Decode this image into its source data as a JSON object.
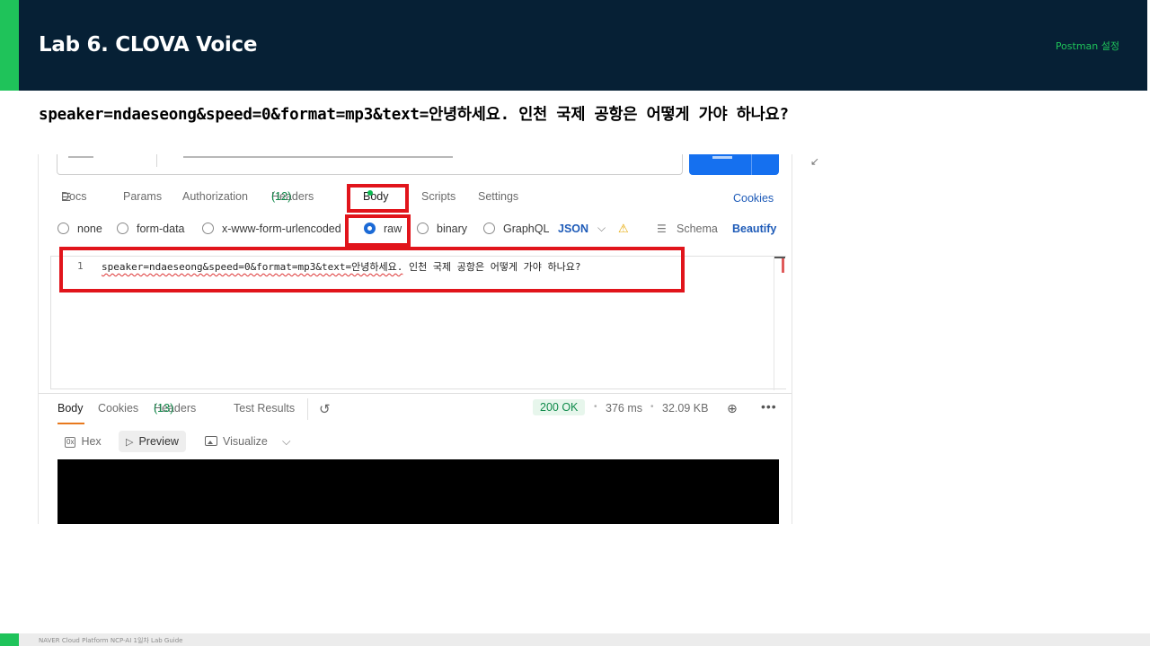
{
  "header": {
    "title": "Lab 6. CLOVA Voice",
    "right_label": "Postman 설정"
  },
  "body_param_line": "speaker=ndaeseong&speed=0&format=mp3&text=안녕하세요. 인천 국제 공항은 어떻게 가야 하나요?",
  "request_tabs": {
    "docs": "Docs",
    "params": "Params",
    "authorization": "Authorization",
    "headers_label": "Headers",
    "headers_count": "(12)",
    "body": "Body",
    "scripts": "Scripts",
    "settings": "Settings",
    "cookies": "Cookies"
  },
  "body_types": {
    "none": "none",
    "form_data": "form-data",
    "urlencoded": "x-www-form-urlencoded",
    "raw": "raw",
    "binary": "binary",
    "graphql": "GraphQL",
    "selected": "raw",
    "format": "JSON",
    "schema": "Schema",
    "beautify": "Beautify"
  },
  "editor": {
    "line_number": "1",
    "code_underlined": "speaker=ndaeseong&speed=0&format=mp3&text=안녕하세요.",
    "code_rest": " 인천 국제 공항은 어떻게 가야 하나요?"
  },
  "response_tabs": {
    "body": "Body",
    "cookies": "Cookies",
    "headers_label": "Headers",
    "headers_count": "(13)",
    "test_results": "Test Results"
  },
  "response_status": {
    "status": "200 OK",
    "time": "376 ms",
    "size": "32.09 KB"
  },
  "view_modes": {
    "hex_icon": "0x",
    "hex": "Hex",
    "preview": "Preview",
    "visualize": "Visualize"
  },
  "icons": {
    "docs": "docs-icon",
    "history": "history-icon",
    "globe": "globe-icon",
    "more": "more-icon",
    "warning": "warning-icon",
    "schema": "schema-icon",
    "expand": "expand-icon"
  },
  "colors": {
    "header_bg": "#062035",
    "accent_green": "#1fc35a",
    "highlight_red": "#e1141b",
    "link_blue": "#1e5bb8",
    "status_green": "#0f8a4a"
  },
  "footer": {
    "text": "NAVER Cloud Platform  NCP-AI 1일차 Lab Guide"
  }
}
